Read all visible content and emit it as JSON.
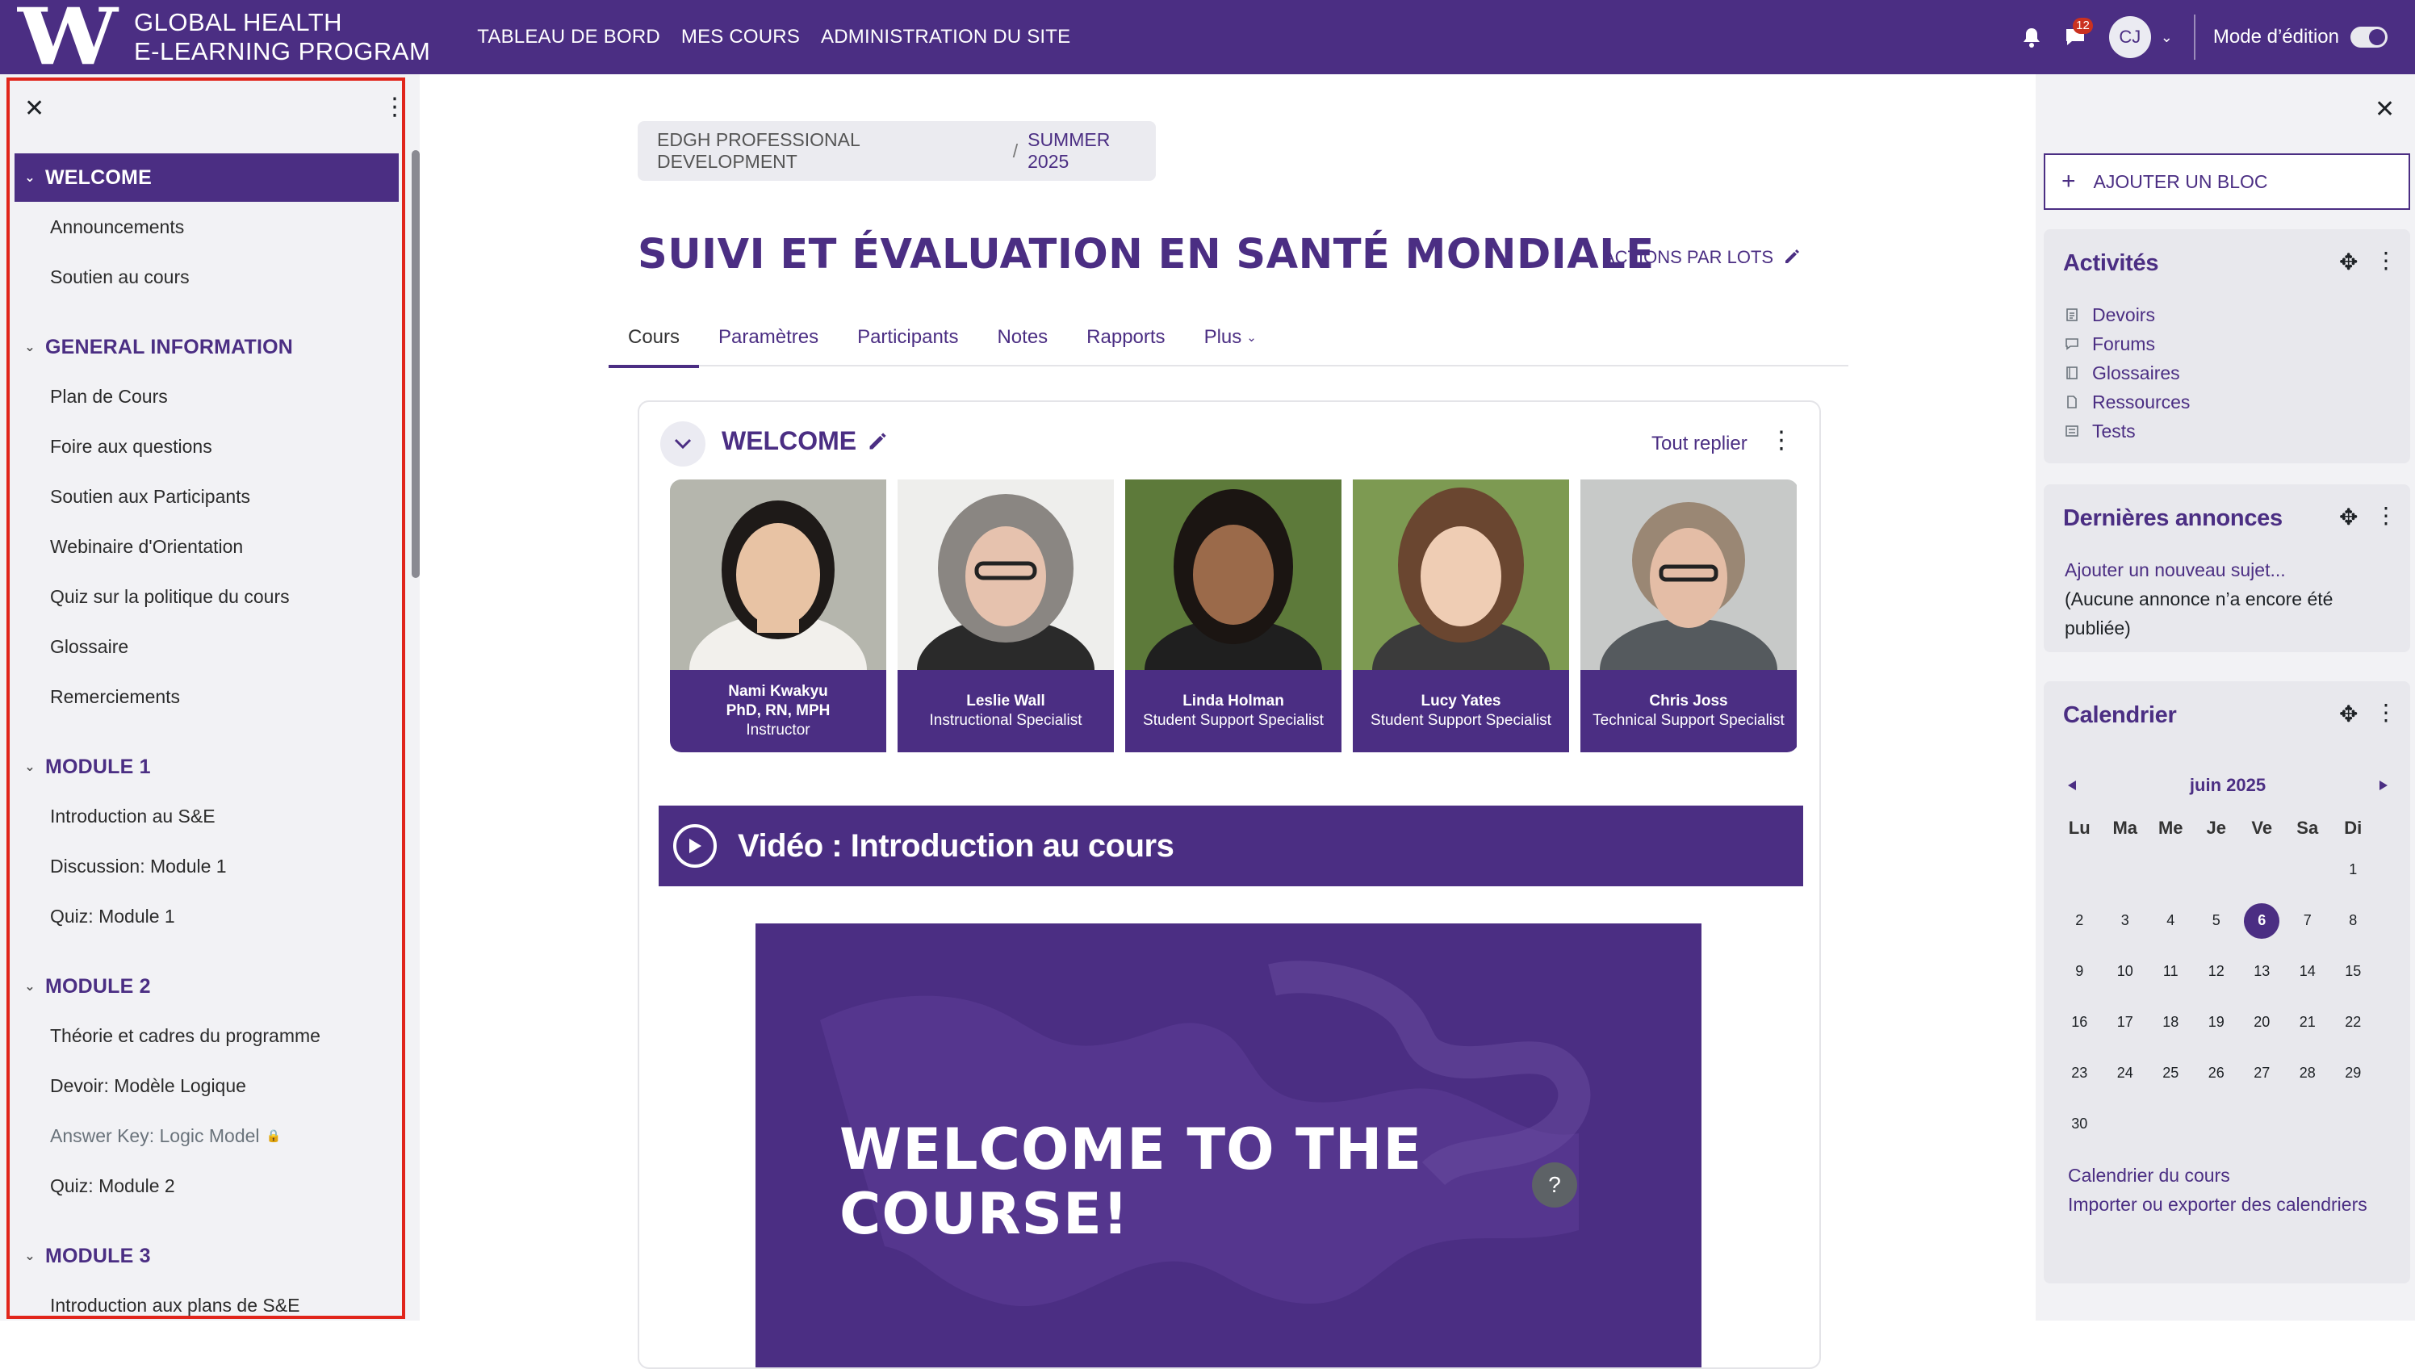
{
  "brand": {
    "logo_letter": "W",
    "line1": "GLOBAL HEALTH",
    "line2": "E-LEARNING PROGRAM"
  },
  "nav": {
    "dashboard": "TABLEAU DE BORD",
    "my_courses": "MES COURS",
    "site_admin": "ADMINISTRATION DU SITE"
  },
  "user": {
    "message_count": "12",
    "initials": "CJ",
    "edit_mode_label": "Mode d’édition"
  },
  "course_index": {
    "sections": [
      {
        "title": "WELCOME",
        "items": [
          "Announcements",
          "Soutien au cours"
        ]
      },
      {
        "title": "GENERAL INFORMATION",
        "items": [
          "Plan de Cours",
          "Foire aux questions",
          "Soutien aux Participants",
          "Webinaire d'Orientation",
          "Quiz sur la politique du cours",
          "Glossaire",
          "Remerciements"
        ]
      },
      {
        "title": "MODULE 1",
        "items": [
          "Introduction au S&E",
          "Discussion: Module 1",
          "Quiz: Module 1"
        ]
      },
      {
        "title": "MODULE 2",
        "items": [
          "Théorie et cadres du programme",
          "Devoir: Modèle Logique",
          "Answer Key: Logic Model",
          "Quiz: Module 2"
        ]
      },
      {
        "title": "MODULE 3",
        "items": [
          "Introduction aux plans de S&E"
        ]
      }
    ]
  },
  "breadcrumb": {
    "parent": "EDGH PROFESSIONAL DEVELOPMENT",
    "separator": "/",
    "current": "SUMMER 2025"
  },
  "course": {
    "title": "SUIVI ET ÉVALUATION EN SANTÉ MONDIALE",
    "bulk_actions": "ACTIONS PAR LOTS"
  },
  "tabs": [
    "Cours",
    "Paramètres",
    "Participants",
    "Notes",
    "Rapports",
    "Plus"
  ],
  "section": {
    "title": "WELCOME",
    "collapse_all": "Tout replier",
    "staff": [
      {
        "name": "Nami Kwakyu",
        "credentials": "PhD, RN, MPH",
        "role": "Instructor"
      },
      {
        "name": "Leslie Wall",
        "credentials": "",
        "role": "Instructional Specialist"
      },
      {
        "name": "Linda Holman",
        "credentials": "",
        "role": "Student Support Specialist"
      },
      {
        "name": "Lucy Yates",
        "credentials": "",
        "role": "Student Support Specialist"
      },
      {
        "name": "Chris Joss",
        "credentials": "",
        "role": "Technical Support Specialist"
      }
    ],
    "video_title": "Vidéo : Introduction au cours",
    "welcome_line1": "WELCOME TO THE",
    "welcome_line2": "COURSE!"
  },
  "help_label": "?",
  "right_drawer": {
    "add_block": "AJOUTER UN BLOC",
    "activities": {
      "title": "Activités",
      "items": [
        "Devoirs",
        "Forums",
        "Glossaires",
        "Ressources",
        "Tests"
      ]
    },
    "news": {
      "title": "Dernières annonces",
      "add_link": "Ajouter un nouveau sujet...",
      "empty": "(Aucune annonce n’a encore été publiée)"
    },
    "calendar": {
      "title": "Calendrier",
      "month": "juin 2025",
      "weekdays": [
        "Lu",
        "Ma",
        "Me",
        "Je",
        "Ve",
        "Sa",
        "Di"
      ],
      "weeks": [
        [
          "",
          "",
          "",
          "",
          "",
          "",
          "1"
        ],
        [
          "2",
          "3",
          "4",
          "5",
          "6",
          "7",
          "8"
        ],
        [
          "9",
          "10",
          "11",
          "12",
          "13",
          "14",
          "15"
        ],
        [
          "16",
          "17",
          "18",
          "19",
          "20",
          "21",
          "22"
        ],
        [
          "23",
          "24",
          "25",
          "26",
          "27",
          "28",
          "29"
        ],
        [
          "30",
          "",
          "",
          "",
          "",
          "",
          ""
        ]
      ],
      "today": "6",
      "course_calendar_link": "Calendrier du cours",
      "import_export_link": "Importer ou exporter des calendriers"
    }
  },
  "colors": {
    "brand_purple": "#4b2e83",
    "drawer_bg": "#f2f2f5",
    "highlight_red": "#e1251b"
  }
}
